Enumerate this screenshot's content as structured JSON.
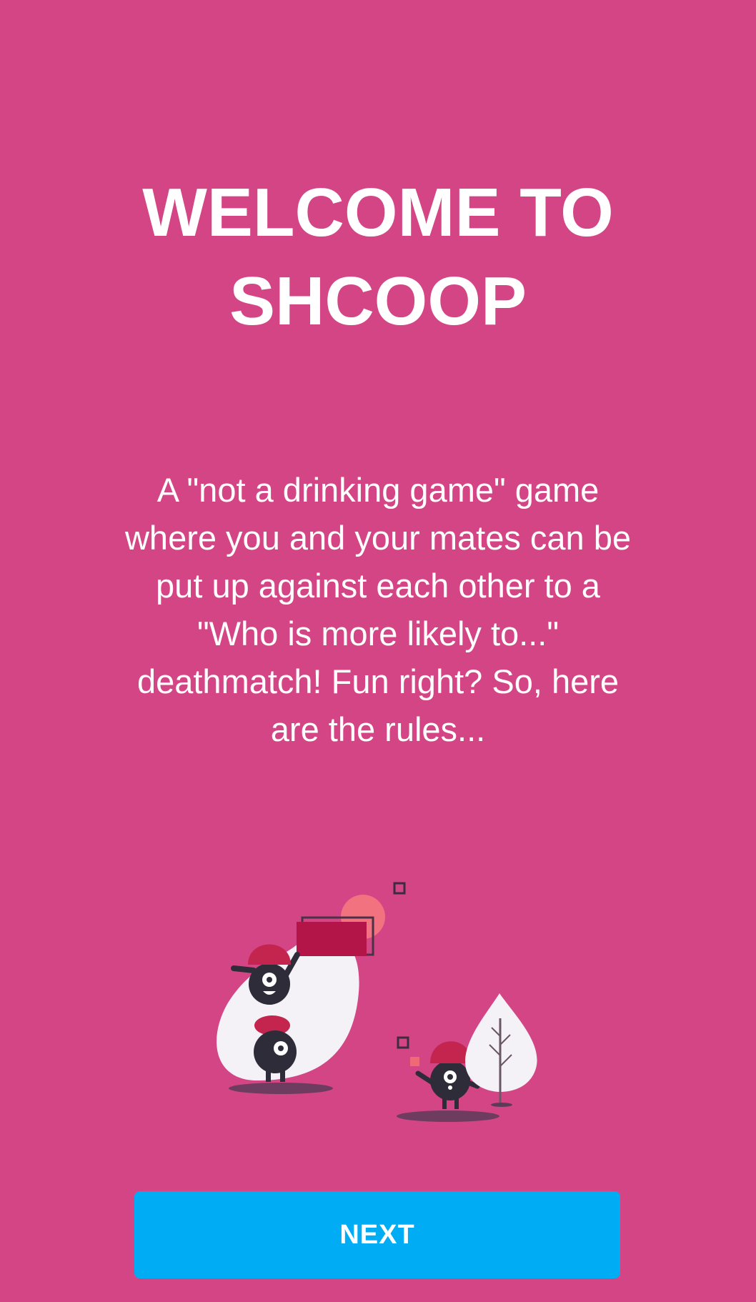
{
  "welcome": {
    "title_lines": [
      "WELCOME TO",
      "SHCOOP"
    ],
    "description_lines": [
      "A \"not a drinking game\" game",
      "where you and your mates can be",
      "put up against each other to a",
      "\"Who is more likely to...\"",
      "deathmatch! Fun right? So, here",
      "are the rules..."
    ]
  },
  "actions": {
    "next_label": "NEXT"
  },
  "colors": {
    "background": "#d44585",
    "button": "#00adf5",
    "text": "#ffffff",
    "character_body": "#2f2c3a",
    "hat": "#c4254f",
    "leaf": "#f4f2f6"
  }
}
